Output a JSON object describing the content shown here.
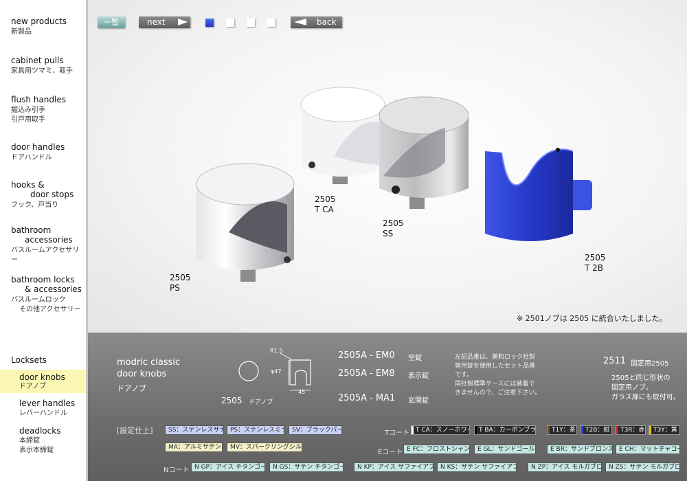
{
  "colors": {
    "accent_yellow": "#fbf6b3",
    "band_gray": "#7a7a7a",
    "page_dot_active": "#2a4ad8",
    "knob_blue": "#2b3fd6"
  },
  "sidebar": {
    "items": [
      {
        "en": "new products",
        "jp": "新製品"
      },
      {
        "en": "cabinet pulls",
        "jp": "家具用ツマミ、取手"
      },
      {
        "en": "flush handles",
        "jp": "掘込み引手",
        "jp2": "引戸用取手"
      },
      {
        "en": "door handles",
        "jp": "ドアハンドル"
      },
      {
        "en": "hooks &",
        "en2": "door stops",
        "jp": "フック、戸当り"
      },
      {
        "en": "bathroom",
        "en2": "accessories",
        "jp": "バスルームアクセサリー"
      },
      {
        "en": "bathroom locks",
        "en2": "& accessories",
        "jp": "バスルームロック",
        "jp2": "その他アクセサリー"
      }
    ],
    "locksets_header": "Locksets",
    "locksets": [
      {
        "en": "door knobs",
        "jp": "ドアノブ",
        "active": true
      },
      {
        "en": "lever handles",
        "jp": "レバーハンドル"
      },
      {
        "en": "deadlocks",
        "jp": "本締錠",
        "jp2": "表示本締錠"
      }
    ]
  },
  "toolbar": {
    "list_label": "一覧",
    "next_label": "next",
    "back_label": "back",
    "page_dots": 4,
    "active_page": 1
  },
  "products": [
    {
      "model": "2505",
      "variant": "PS"
    },
    {
      "model": "2505",
      "variant": "T CA"
    },
    {
      "model": "2505",
      "variant": "SS"
    },
    {
      "model": "2505",
      "variant": "T 2B"
    }
  ],
  "notice": "※ 2501ノブは 2505 に統合いたしました。",
  "info": {
    "series": "modric classic",
    "category": "door knobs",
    "category_jp": "ドアノブ",
    "drawing_label_model": "2505",
    "drawing_label_jp": "ドアノブ",
    "dim_r": "R1.5",
    "dim_phi": "φ47",
    "dim_w": "45",
    "codes": [
      {
        "code": "2505A - EM0",
        "desc": "空錠"
      },
      {
        "code": "2505A - EM8",
        "desc": "表示錠"
      },
      {
        "code": "2505A - MA1",
        "desc": "玄関錠"
      }
    ],
    "note_lines": [
      "左記品番は、美和ロック社製",
      "専用錠を使用したセット品番",
      "です。",
      "同社製標準ケースには装着で",
      "きませんので、ご注意下さい。"
    ],
    "side_model": "2511",
    "side_model_desc": "固定用2505",
    "side_lines": [
      "2505と同じ形状の",
      "固定用ノブ。",
      "ガラス扉にも取付可。"
    ]
  },
  "finishes": {
    "header": "[設定仕上]",
    "metal": [
      {
        "label": "SS：ステンレスサテン",
        "tone": "blue"
      },
      {
        "label": "PS：ステンレスミラー",
        "tone": "blue"
      },
      {
        "label": "SV：ブラックパール",
        "tone": "blue"
      },
      {
        "label": "MA：アルミサテン",
        "tone": "yellow"
      },
      {
        "label": "MV：スパークリングシルバー",
        "tone": "yellow"
      }
    ],
    "t_coat_label": "Tコート",
    "t_coat": [
      {
        "label": "T CA：スノーホワイト",
        "swatch": "#ffffff"
      },
      {
        "label": "T BA：カーボンブラック",
        "swatch": "#000000"
      },
      {
        "label": "T1Y：茶",
        "swatch": "#7a4a1a"
      },
      {
        "label": "T2B：紺",
        "swatch": "#2b3fd6"
      },
      {
        "label": "T3R：赤",
        "swatch": "#d02020"
      },
      {
        "label": "T3Y：黄",
        "swatch": "#f0c000"
      }
    ],
    "e_coat_label": "Eコート",
    "e_coat": [
      {
        "label": "E FC：フロストシャンパン"
      },
      {
        "label": "E GL：サンドゴールド"
      },
      {
        "label": "E BR：サンドブロンズ"
      },
      {
        "label": "E CH：マットチャコール"
      }
    ],
    "n_coat_label": "Nコート",
    "n_coat": [
      {
        "label": "N GP：アイス チタンゴールド"
      },
      {
        "label": "N GS：サテン チタンゴールド"
      },
      {
        "label": "N KP：アイス サファイアブラック"
      },
      {
        "label": "N KS：サテン サファイアブラック"
      },
      {
        "label": "N ZP：アイス モルガブロンズ"
      },
      {
        "label": "N ZS：サテン モルガブロンズ"
      }
    ]
  }
}
